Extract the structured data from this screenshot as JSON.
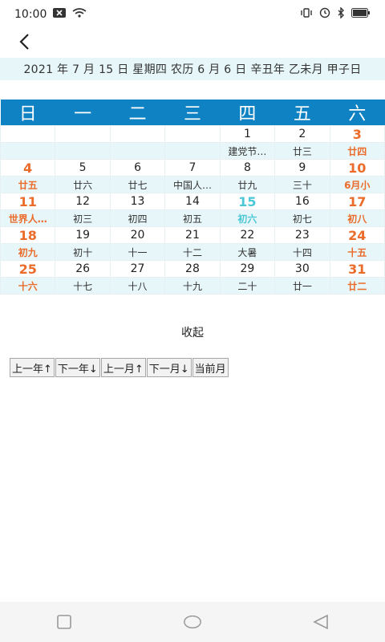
{
  "status_bar": {
    "time": "10:00"
  },
  "header": {
    "back_label": "<"
  },
  "date_line": "2021 年 7 月 15 日 星期四 农历 6 月 6 日 辛丑年 乙未月 甲子日",
  "calendar": {
    "weekdays": [
      "日",
      "一",
      "二",
      "三",
      "四",
      "五",
      "六"
    ],
    "weeks": [
      {
        "days": [
          "",
          "",
          "",
          "",
          "1",
          "2",
          "3"
        ],
        "lunar": [
          "",
          "",
          "",
          "",
          "建党节…",
          "廿三",
          "廿四"
        ]
      },
      {
        "days": [
          "4",
          "5",
          "6",
          "7",
          "8",
          "9",
          "10"
        ],
        "lunar": [
          "廿五",
          "廿六",
          "廿七",
          "中国人…",
          "廿九",
          "三十",
          "6月小"
        ]
      },
      {
        "days": [
          "11",
          "12",
          "13",
          "14",
          "15",
          "16",
          "17"
        ],
        "lunar": [
          "世界人…",
          "初三",
          "初四",
          "初五",
          "初六",
          "初七",
          "初八"
        ]
      },
      {
        "days": [
          "18",
          "19",
          "20",
          "21",
          "22",
          "23",
          "24"
        ],
        "lunar": [
          "初九",
          "初十",
          "十一",
          "十二",
          "大暑",
          "十四",
          "十五"
        ]
      },
      {
        "days": [
          "25",
          "26",
          "27",
          "28",
          "29",
          "30",
          "31"
        ],
        "lunar": [
          "十六",
          "十七",
          "十八",
          "十九",
          "二十",
          "廿一",
          "廿二"
        ]
      }
    ],
    "today": "15",
    "colors": {
      "header_bg": "#0f82c3",
      "weekend": "#ea6b2a",
      "today": "#4cc7d6",
      "lunar_row_bg": "#e7f6f8"
    }
  },
  "collapse_label": "收起",
  "nav_buttons": {
    "prev_year": "上一年↑",
    "next_year": "下一年↓",
    "prev_month": "上一月↑",
    "next_month": "下一月↓",
    "current_month": "当前月"
  },
  "system_nav": {
    "icons": [
      "recent-apps-icon",
      "home-icon",
      "back-icon"
    ]
  }
}
